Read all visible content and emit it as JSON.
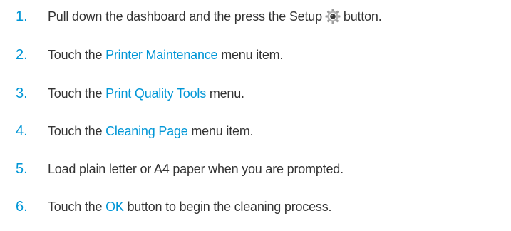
{
  "accent_color": "#0096d6",
  "text_color": "#333333",
  "steps": [
    {
      "number": "1.",
      "pre": "Pull down the dashboard and the press the Setup",
      "icon": "gear-icon",
      "post": "button."
    },
    {
      "number": "2.",
      "pre": "Touch the",
      "link": "Printer Maintenance",
      "post": "menu item."
    },
    {
      "number": "3.",
      "pre": "Touch the",
      "link": "Print Quality Tools",
      "post": "menu."
    },
    {
      "number": "4.",
      "pre": "Touch the",
      "link": "Cleaning Page",
      "post": "menu item."
    },
    {
      "number": "5.",
      "text": "Load plain letter or A4 paper when you are prompted."
    },
    {
      "number": "6.",
      "pre": "Touch the",
      "link": "OK",
      "post": "button to begin the cleaning process."
    }
  ]
}
